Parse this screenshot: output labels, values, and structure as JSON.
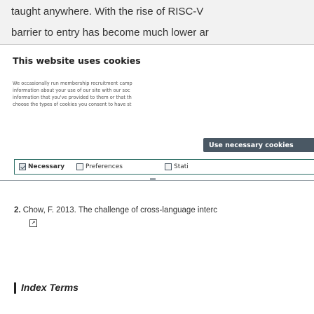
{
  "article": {
    "paragraph_lines": [
      "taught anywhere. With the rise of RISC-V",
      "barrier to entry has become much lower ar"
    ]
  },
  "cookie_banner": {
    "title": "This website uses cookies",
    "body_lines": [
      "We occasionally run membership recruitment camp",
      "information about your use of our site with our soc",
      "information that you've provided to them or that th",
      "choose the types of cookies you consent to have st"
    ],
    "use_necessary_label": "Use necessary cookies",
    "options": [
      {
        "label": "Necessary",
        "checked": true
      },
      {
        "label": "Preferences",
        "checked": false
      },
      {
        "label": "Stati",
        "checked": false
      }
    ]
  },
  "references": {
    "item": {
      "number": "2.",
      "text": "Chow, F. 2013. The challenge of cross-language interc",
      "icon": "external-reference-icon"
    }
  },
  "index_terms": {
    "title": "Index Terms"
  }
}
